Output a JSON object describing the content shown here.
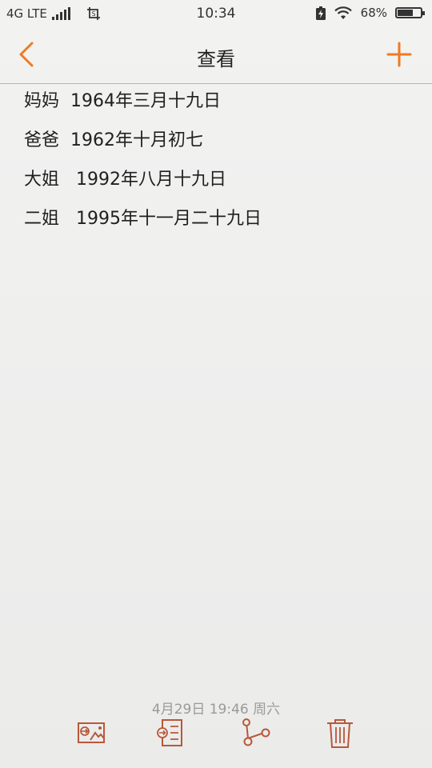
{
  "status_bar": {
    "network": "4G LTE",
    "time": "10:34",
    "battery_percent": "68%",
    "battery_level": 0.68,
    "icons": [
      "signal-icon",
      "screenshot-icon",
      "battery-saver-icon",
      "wifi-icon",
      "battery-icon"
    ]
  },
  "header": {
    "title": "查看",
    "back_icon": "chevron-left-icon",
    "add_icon": "plus-icon"
  },
  "note": {
    "lines": [
      "妈妈  1964年三月十九日",
      "爸爸  1962年十月初七",
      "大姐   1992年八月十九日",
      "二姐   1995年十一月二十九日"
    ]
  },
  "footer": {
    "timestamp": "4月29日 19:46 周六",
    "tools": [
      "share-as-image-icon",
      "export-icon",
      "share-icon",
      "trash-icon"
    ]
  },
  "colors": {
    "accent": "#f07a22",
    "tool_icon": "#b8583a",
    "text": "#1f1f1f",
    "muted": "#9a9a9a"
  }
}
